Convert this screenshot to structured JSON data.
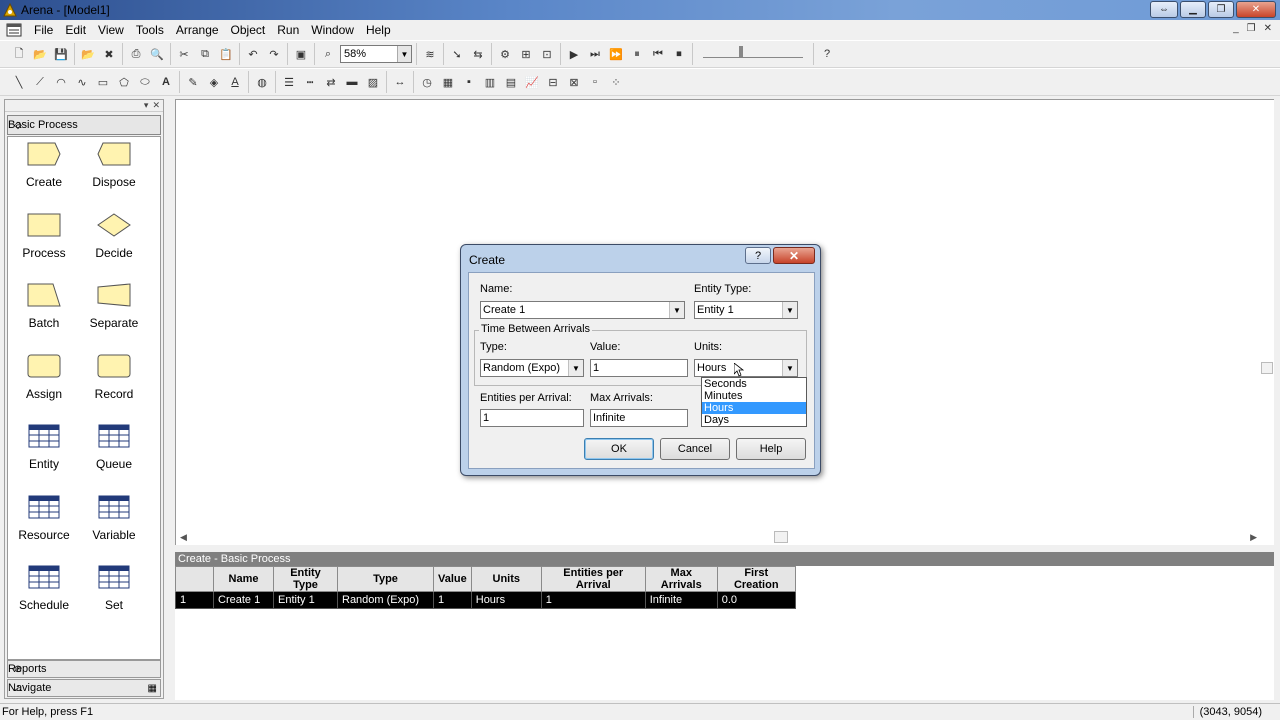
{
  "window": {
    "title": "Arena - [Model1]"
  },
  "menu": [
    "File",
    "Edit",
    "View",
    "Tools",
    "Arrange",
    "Object",
    "Run",
    "Window",
    "Help"
  ],
  "toolbar": {
    "zoom_value": "58%"
  },
  "left_panel": {
    "header": "Basic Process",
    "modules": [
      {
        "label": "Create",
        "shape": "create"
      },
      {
        "label": "Dispose",
        "shape": "dispose"
      },
      {
        "label": "Process",
        "shape": "process"
      },
      {
        "label": "Decide",
        "shape": "decide"
      },
      {
        "label": "Batch",
        "shape": "batch"
      },
      {
        "label": "Separate",
        "shape": "separate"
      },
      {
        "label": "Assign",
        "shape": "assign"
      },
      {
        "label": "Record",
        "shape": "record"
      },
      {
        "label": "Entity",
        "shape": "grid"
      },
      {
        "label": "Queue",
        "shape": "grid"
      },
      {
        "label": "Resource",
        "shape": "grid"
      },
      {
        "label": "Variable",
        "shape": "grid"
      },
      {
        "label": "Schedule",
        "shape": "grid"
      },
      {
        "label": "Set",
        "shape": "grid"
      }
    ],
    "footer_reports": "Reports",
    "footer_navigate": "Navigate"
  },
  "spreadsheet": {
    "title": "Create - Basic Process",
    "columns": [
      "",
      "Name",
      "Entity Type",
      "Type",
      "Value",
      "Units",
      "Entities per Arrival",
      "Max Arrivals",
      "First Creation"
    ],
    "rows": [
      [
        "1",
        "Create 1",
        "Entity 1",
        "Random (Expo)",
        "1",
        "Hours",
        "1",
        "Infinite",
        "0.0"
      ]
    ]
  },
  "dialog": {
    "title": "Create",
    "help_glyph": "?",
    "close_glyph": "✕",
    "name_label": "Name:",
    "name_value": "Create 1",
    "entity_type_label": "Entity Type:",
    "entity_type_value": "Entity 1",
    "group_title": "Time Between Arrivals",
    "type_label": "Type:",
    "type_value": "Random (Expo)",
    "value_label": "Value:",
    "value_value": "1",
    "units_label": "Units:",
    "units_value": "Hours",
    "units_options": [
      "Seconds",
      "Minutes",
      "Hours",
      "Days"
    ],
    "units_selected_index": 2,
    "entities_per_arrival_label": "Entities per Arrival:",
    "entities_per_arrival_value": "1",
    "max_arrivals_label": "Max Arrivals:",
    "max_arrivals_value": "Infinite",
    "ok_label": "OK",
    "cancel_label": "Cancel",
    "help_label": "Help"
  },
  "status": {
    "help_text": "For Help, press F1",
    "coords": "(3043, 9054)"
  },
  "colors": {
    "selection": "#3399ff",
    "module_fill": "#fff3b0",
    "sheet_row_bg": "#000000"
  }
}
